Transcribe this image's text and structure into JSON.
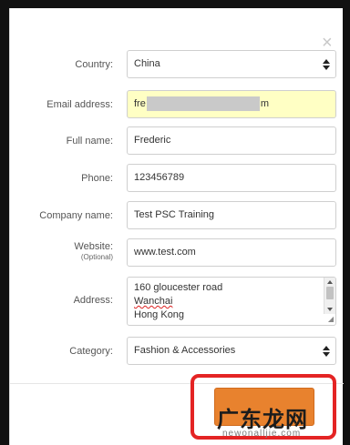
{
  "dialog": {
    "close_glyph": "×",
    "fields": {
      "country": {
        "label": "Country:",
        "value": "China"
      },
      "email": {
        "label": "Email address:",
        "value_prefix": "fre",
        "value_suffix": "m"
      },
      "full_name": {
        "label": "Full name:",
        "value": "Frederic"
      },
      "phone": {
        "label": "Phone:",
        "value": "123456789"
      },
      "company": {
        "label": "Company name:",
        "value": "Test PSC Training"
      },
      "website": {
        "label": "Website:",
        "sublabel": "(Optional)",
        "value": "www.test.com"
      },
      "address": {
        "label": "Address:",
        "lines": [
          "160 gloucester road",
          "Wanchai",
          "Hong Kong"
        ]
      },
      "category": {
        "label": "Category:",
        "value": "Fashion & Accessories"
      }
    }
  },
  "watermark": {
    "text": "广东龙网",
    "subtext": "newonalljie.com"
  },
  "colors": {
    "highlight": "#e42424",
    "submit": "#e8822e",
    "email_autofill": "#ffffc4"
  }
}
